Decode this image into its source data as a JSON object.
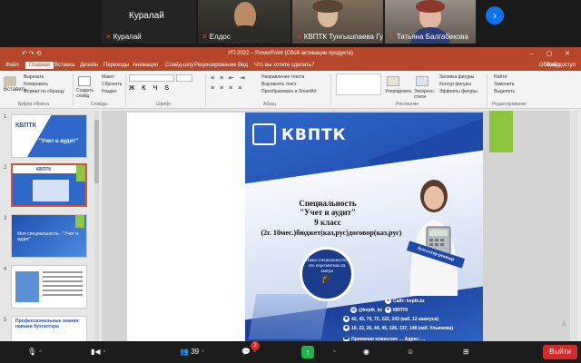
{
  "participants": [
    {
      "name": "Куралай",
      "big_name": "Куралай",
      "muted": true
    },
    {
      "name": "Елдос",
      "muted": true
    },
    {
      "name": "КВПТК Тунгышпаева Гул...",
      "muted": true
    },
    {
      "name": "Татьяна Балгабекова",
      "muted": true
    }
  ],
  "powerpoint": {
    "window_title": "УП-2022 – PowerPoint (Сбой активации продукта)",
    "quick_access": "↶ ↷ ⟲",
    "window_controls": "– ▢ ✕",
    "tabs": [
      "Файл",
      "Главная",
      "Вставка",
      "Дизайн",
      "Переходы",
      "Анимация",
      "Слайд-шоу",
      "Рецензирование",
      "Вид",
      "Что вы хотите сделать?"
    ],
    "active_tab": "Главная",
    "login": "Вход",
    "share": "Общий доступ",
    "ribbon": {
      "paste": "Вставить",
      "cut": "Вырезать",
      "copy": "Копировать",
      "format_painter": "Формат по образцу",
      "clipboard_group": "Буфер обмена",
      "create_slide": "Создать слайд",
      "layout": "Макет",
      "reset": "Сбросить",
      "section": "Раздел",
      "slides_group": "Слайды",
      "font_group": "Шрифт",
      "paragraph_group": "Абзац",
      "text_direction": "Направление текста",
      "align_text": "Выровнять текст",
      "smartart": "Преобразовать в SmartArt",
      "arrange": "Упорядочить",
      "quick_styles": "Экспресс-стили",
      "shape_fill": "Заливка фигуры",
      "shape_outline": "Контур фигуры",
      "shape_effects": "Эффекты фигуры",
      "drawing_group": "Рисование",
      "find": "Найти",
      "replace": "Заменить",
      "select": "Выделить",
      "editing_group": "Редактирование"
    },
    "slides": [
      {
        "num": "1",
        "caption": "\"Учет и аудит\"",
        "logo": "КВПТК"
      },
      {
        "num": "2",
        "caption": "",
        "logo": "КВПТК"
      },
      {
        "num": "3",
        "caption": "Моя специальность - \"Учет и аудит\"",
        "logo": ""
      },
      {
        "num": "4",
        "caption": "",
        "logo": ""
      },
      {
        "num": "5",
        "caption": "Профессиональные знания: навыки бухгалтера",
        "logo": ""
      }
    ]
  },
  "poster": {
    "logo": "КВПТК",
    "line1": "Специальность",
    "line2": "\"Учет и аудит\"",
    "line3": "9 класс",
    "line4": "(2г. 10мес.)бюджет(каз,рус)договор(каз,рус)",
    "badge_text": "Наша специальность- это перспектива на завтра",
    "tag": "бухгалтер-ревизор",
    "contacts": [
      "Сайт: kvptk.kz",
      "@kvptk_kz",
      "КВПТК",
      "42, 43, 70, 72, 222, 243 (каб. 12 кампуса)",
      "10, 22, 26, 44, 45, 126, 137, 148 (каб. Ульянова)",
      "Приемная комиссия: ...   Адрес: ..."
    ],
    "colors": {
      "primary": "#2452b3",
      "dark": "#1c3f99"
    }
  },
  "toolbar": {
    "participants_count": "39",
    "chat_badge": "2",
    "leave": "Выйти",
    "share_icon": "share-screen-icon"
  },
  "watermark": "А"
}
